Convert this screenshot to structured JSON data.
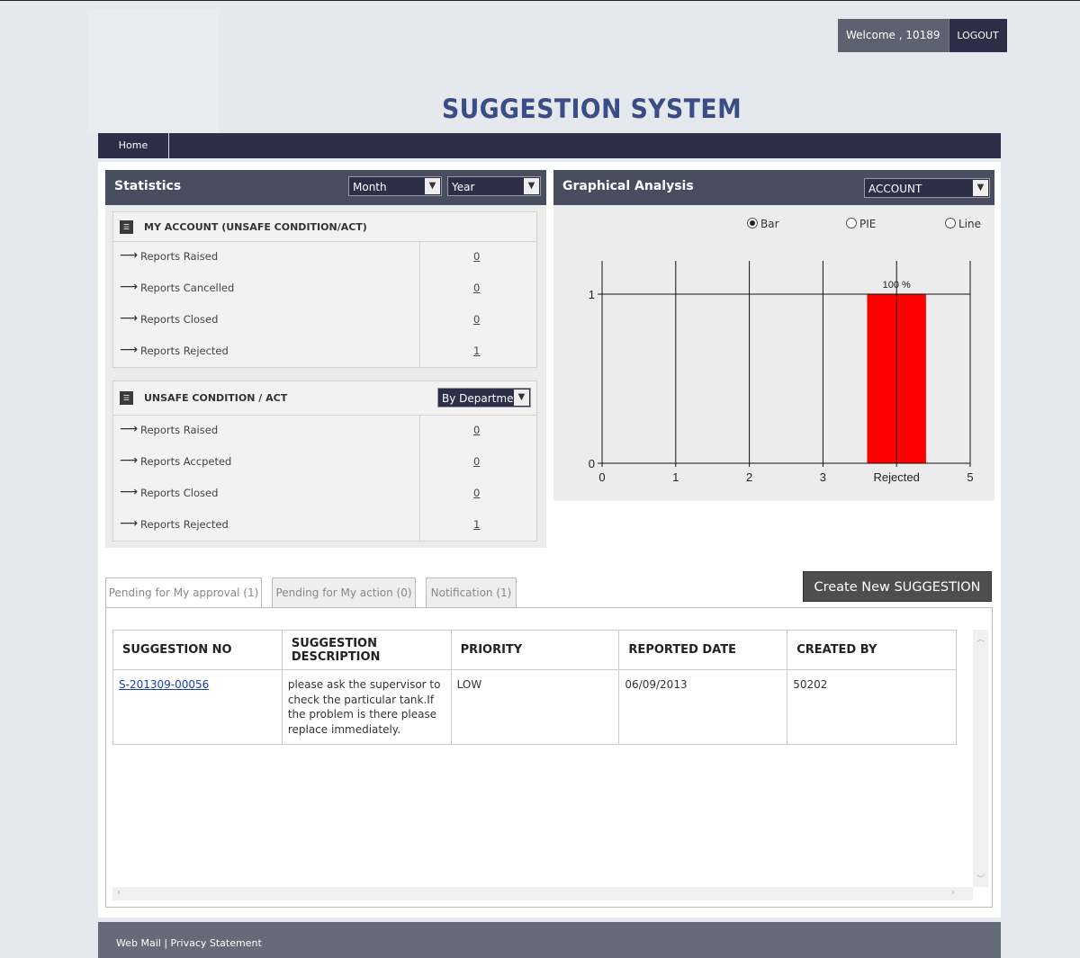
{
  "header": {
    "welcome": "Welcome , 10189",
    "logout": "LOGOUT",
    "title": "SUGGESTION SYSTEM"
  },
  "nav": {
    "home": "Home"
  },
  "statistics": {
    "title": "Statistics",
    "month_select": "Month",
    "year_select": "Year",
    "my_account": {
      "title": "MY ACCOUNT (UNSAFE CONDITION/ACT)",
      "rows": [
        {
          "label": "Reports Raised",
          "value": "0"
        },
        {
          "label": "Reports Cancelled",
          "value": "0"
        },
        {
          "label": "Reports Closed",
          "value": "0"
        },
        {
          "label": "Reports Rejected",
          "value": "1"
        }
      ]
    },
    "unsafe": {
      "title": "UNSAFE CONDITION / ACT",
      "filter": "By Departmen",
      "rows": [
        {
          "label": "Reports Raised",
          "value": "0"
        },
        {
          "label": "Reports Accpeted",
          "value": "0"
        },
        {
          "label": "Reports Closed",
          "value": "0"
        },
        {
          "label": "Reports Rejected",
          "value": "1"
        }
      ]
    }
  },
  "graph": {
    "title": "Graphical Analysis",
    "account_select": "ACCOUNT",
    "options": [
      "Bar",
      "PIE",
      "Line"
    ],
    "selected": "Bar",
    "colors": {
      "bar": "#ff0000"
    }
  },
  "chart_data": {
    "type": "bar",
    "x_ticks": [
      "0",
      "1",
      "2",
      "3",
      "Rejected",
      "5"
    ],
    "y_ticks": [
      "0",
      "1"
    ],
    "ylim": [
      0,
      1
    ],
    "bars": [
      {
        "x": 4,
        "category": "Rejected",
        "value": 1,
        "label": "100 %"
      }
    ]
  },
  "tabs": [
    "Pending for My approval (1)",
    "Pending for My action (0)",
    "Notification (1)"
  ],
  "create_button": "Create New SUGGESTION",
  "table": {
    "headers": [
      "SUGGESTION NO",
      "SUGGESTION DESCRIPTION",
      "PRIORITY",
      "REPORTED DATE",
      "CREATED BY"
    ],
    "rows": [
      [
        "S-201309-00056",
        "please ask the supervisor to check the particular tank.If the problem is there please replace immediately.",
        "LOW",
        "06/09/2013",
        "50202"
      ]
    ]
  },
  "footer": {
    "webmail": "Web Mail",
    "separator": "|",
    "privacy": "Privacy Statement"
  }
}
